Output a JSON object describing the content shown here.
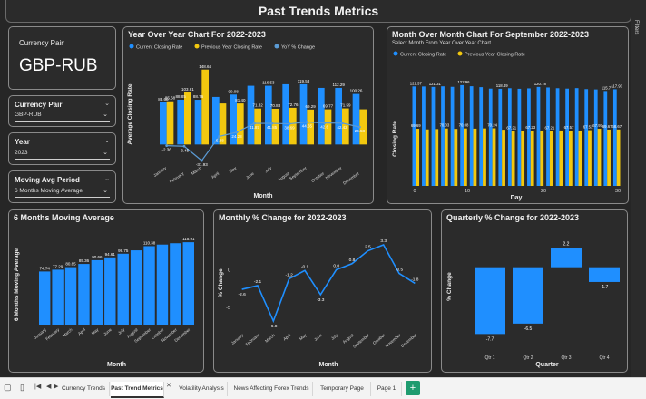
{
  "page_title": "Past Trends Metrics",
  "currency_card": {
    "label": "Currency Pair",
    "value": "GBP-RUB"
  },
  "filters": [
    {
      "label": "Currency Pair",
      "value": "GBP-RUB"
    },
    {
      "label": "Year",
      "value": "2023"
    },
    {
      "label": "Moving Avg Period",
      "value": "6 Months Moving Average"
    }
  ],
  "colors": {
    "current": "#1f8fff",
    "previous": "#f2c80f",
    "yoy": "#5b9bd5",
    "background": "#262626"
  },
  "side_panel": {
    "label": "Filters"
  },
  "tabs": [
    "Currency Trends",
    "Past Trend Metrics",
    "Volatility Analysis",
    "News Affecting Forex Trends",
    "Temporary Page",
    "Page 1"
  ],
  "add_tab_label": "+",
  "chart_data": [
    {
      "type": "bar",
      "title": "Year Over Year Chart For 2022-2023",
      "xlabel": "Month",
      "ylabel": "Average Closing Rate",
      "legend": [
        "Current Closing Rate",
        "Previous Year Closing Rate",
        "YoY % Change"
      ],
      "legend_position": "top",
      "categories": [
        "January",
        "February",
        "March",
        "April",
        "May",
        "June",
        "July",
        "August",
        "September",
        "October",
        "November",
        "December"
      ],
      "series": [
        {
          "name": "Current Closing Rate",
          "values": [
            83.68,
            88.85,
            88.76,
            94.34,
            99.08,
            116.53,
            116.53,
            119.53,
            119.53,
            112.29,
            112.29,
            100.26
          ]
        },
        {
          "name": "Previous Year Closing Rate",
          "values": [
            85.68,
            103.61,
            148.64,
            81.4,
            81.4,
            71.32,
            70.83,
            72.76,
            69.29,
            69.77,
            71.59,
            69.77
          ]
        },
        {
          "name": "YoY % Change",
          "values": [
            -2.36,
            -3.45,
            -31.93,
            16.02,
            24.28,
            41.87,
            41.85,
            40.95,
            44.65,
            42.6,
            42.42,
            34.59
          ]
        }
      ],
      "bar_labels": {
        "current": [
          "83.68",
          "88.85",
          "88.76",
          "",
          "99.08",
          "",
          "116.53",
          "",
          "119.53",
          "",
          "112.29",
          "100.26"
        ],
        "previous": [
          "85.68",
          "103.61",
          "148.64",
          "",
          "81.40",
          "71.32",
          "70.83",
          "72.76",
          "69.29",
          "69.77",
          "71.59",
          ""
        ],
        "yoy": [
          "-2.36",
          "-3.45",
          "-31.93",
          "-5.38",
          "24.28",
          "41.87",
          "41.85",
          "38.69",
          "44.65",
          "42.6",
          "42.42",
          "24.58"
        ]
      }
    },
    {
      "type": "bar",
      "title": "Month Over Month Chart For September 2022-2023",
      "subtitle": "Select Month From Year Over Year Chart",
      "xlabel": "Day",
      "ylabel": "Closing Rate",
      "legend": [
        "Current Closing Rate",
        "Previous Year Closing Rate"
      ],
      "x_ticks": [
        "0",
        "10",
        "20",
        "30"
      ],
      "data_labels": [
        "121.37",
        "121.31",
        "122.96",
        "118.49",
        "120.78",
        "115.77",
        "117.93",
        "69.69",
        "70.03",
        "70.08",
        "70.24",
        "67.21",
        "67.23",
        "67.21",
        "67.57",
        "67.52",
        "67.97",
        "69.67",
        "68.67"
      ],
      "current": [
        121.37,
        121.31,
        120.8,
        121.5,
        120.9,
        122.96,
        121.6,
        120.5,
        118.7,
        118.49,
        119.2,
        118.5,
        119.0,
        120.78,
        120.1,
        119.2,
        118.7,
        119.3,
        118.1,
        117.7,
        115.77,
        117.93
      ],
      "previous": [
        69.69,
        68.9,
        69.3,
        70.03,
        69.5,
        70.08,
        69.8,
        70.1,
        70.24,
        68.5,
        67.21,
        67.5,
        67.23,
        66.9,
        67.21,
        67.57,
        67.3,
        67.52,
        67.97,
        69.67,
        68.67,
        68.8
      ]
    },
    {
      "type": "bar",
      "title": "6 Months Moving Average",
      "xlabel": "Month",
      "ylabel": "6 Months Moving Average",
      "categories": [
        "January",
        "February",
        "March",
        "April",
        "May",
        "June",
        "July",
        "August",
        "September",
        "October",
        "November",
        "December"
      ],
      "values": [
        74.74,
        77.29,
        80.85,
        85.36,
        90.66,
        94.61,
        99.75,
        104.5,
        110.38,
        112.6,
        114.5,
        115.91
      ],
      "labels": [
        "74.74",
        "77.29",
        "80.85",
        "85.36",
        "90.66",
        "94.61",
        "99.75",
        "",
        "110.38",
        "",
        "",
        "115.91"
      ]
    },
    {
      "type": "line",
      "title": "Monthly % Change for 2022-2023",
      "xlabel": "Month",
      "ylabel": "% Change",
      "categories": [
        "January",
        "February",
        "March",
        "April",
        "May",
        "June",
        "July",
        "August",
        "September",
        "October",
        "November",
        "December"
      ],
      "values": [
        -2.6,
        -2.1,
        -6.8,
        -1.2,
        -0.1,
        -3.3,
        0.0,
        0.8,
        2.5,
        3.3,
        -0.5,
        -1.8
      ],
      "labels": [
        "-2.6",
        "-2.1",
        "-6.8",
        "-1.2",
        "-0.1",
        "-3.3",
        "0.0",
        "0.8",
        "2.5",
        "3.3",
        "-0.5",
        "-1.8"
      ],
      "y_ticks": [
        "0",
        "-5"
      ]
    },
    {
      "type": "bar",
      "title": "Quarterly % Change for 2022-2023",
      "xlabel": "Quarter",
      "ylabel": "% Change",
      "categories": [
        "Qtr 1",
        "Qtr 2",
        "Qtr 3",
        "Qtr 4"
      ],
      "values": [
        -7.7,
        -6.5,
        2.2,
        -1.7
      ],
      "labels": [
        "-7.7",
        "-6.5",
        "2.2",
        "-1.7"
      ]
    }
  ]
}
